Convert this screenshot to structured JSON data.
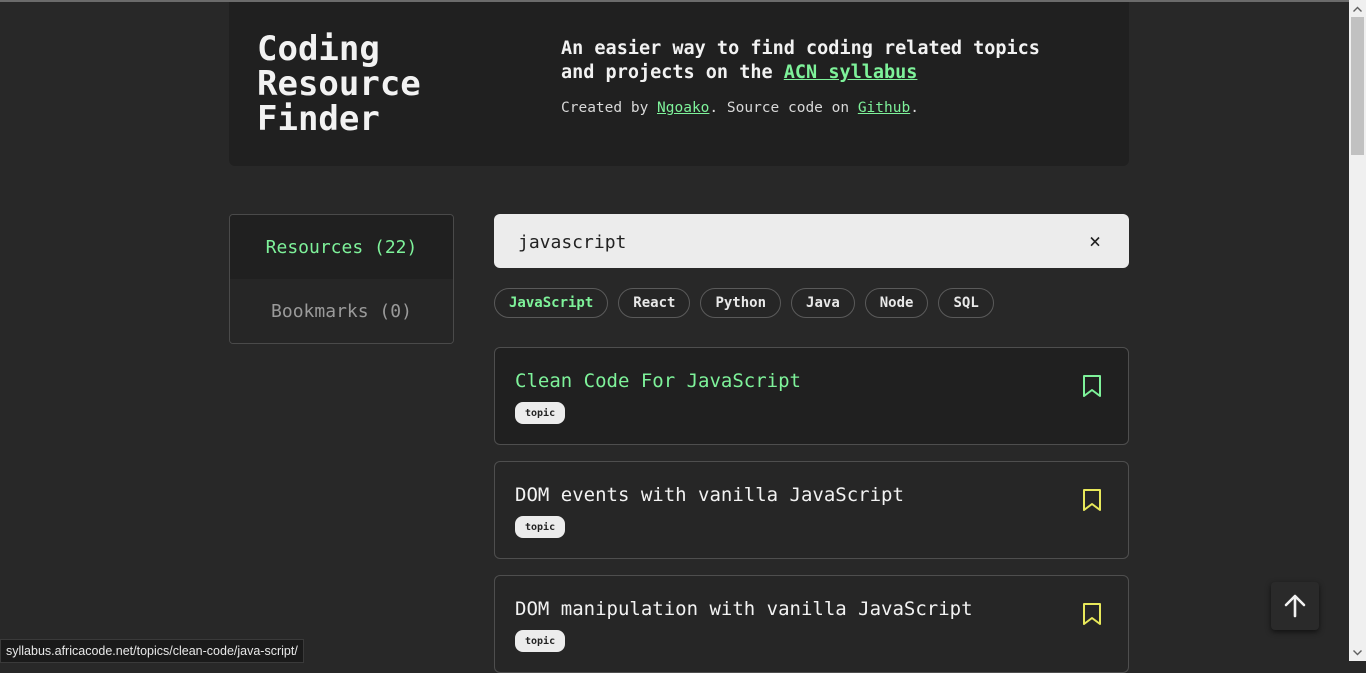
{
  "header": {
    "title": "Coding\nResource\nFinder",
    "tagline_prefix": "An easier way to find coding related topics and projects on the ",
    "tagline_link": "ACN syllabus",
    "credits_prefix": "Created by ",
    "credits_author": "Ngoako",
    "credits_middle": ". Source code on ",
    "credits_source": "Github",
    "credits_suffix": "."
  },
  "sidebar": {
    "items": [
      {
        "label": "Resources (22)"
      },
      {
        "label": "Bookmarks (0)"
      }
    ]
  },
  "search": {
    "value": "javascript",
    "clear_icon": "×"
  },
  "filters": [
    {
      "label": "JavaScript",
      "active": true
    },
    {
      "label": "React"
    },
    {
      "label": "Python"
    },
    {
      "label": "Java"
    },
    {
      "label": "Node"
    },
    {
      "label": "SQL"
    }
  ],
  "results": [
    {
      "title": "Clean Code For JavaScript",
      "tag": "topic",
      "bookmark_color": "#7ef29a"
    },
    {
      "title": "DOM events with vanilla JavaScript",
      "tag": "topic",
      "bookmark_color": "#e8e85a"
    },
    {
      "title": "DOM manipulation with vanilla JavaScript",
      "tag": "topic",
      "bookmark_color": "#e8e85a"
    }
  ],
  "statusbar": {
    "url": "syllabus.africacode.net/topics/clean-code/java-script/"
  },
  "colors": {
    "accent": "#7ef29a",
    "background": "#282828",
    "panel": "#202020"
  }
}
